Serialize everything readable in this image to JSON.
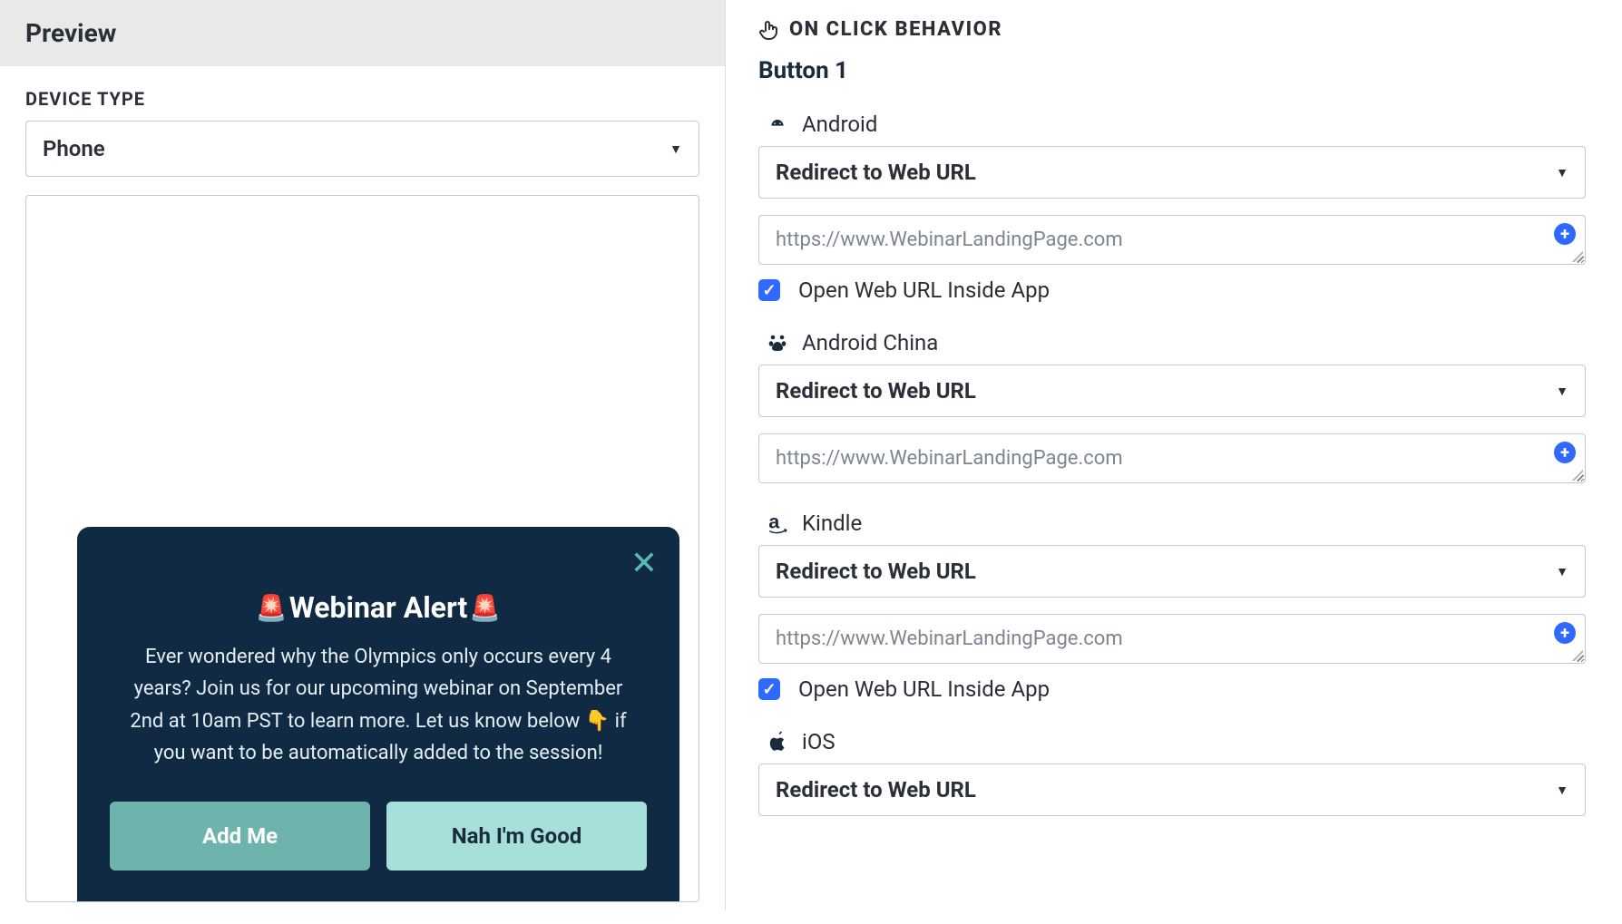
{
  "left": {
    "header": "Preview",
    "deviceTypeLabel": "DEVICE TYPE",
    "deviceTypeValue": "Phone",
    "notification": {
      "title": "Webinar Alert",
      "body": "Ever wondered why the Olympics only occurs every 4 years? Join us for our upcoming webinar on September 2nd at 10am PST to learn more. Let us know below 👇 if you want to be automatically added to the session!",
      "primaryBtn": "Add Me",
      "secondaryBtn": "Nah I'm Good"
    }
  },
  "right": {
    "sectionTitle": "ON CLICK BEHAVIOR",
    "subheader": "Button 1",
    "platforms": [
      {
        "name": "Android",
        "icon": "android-icon",
        "action": "Redirect to Web URL",
        "url": "https://www.WebinarLandingPage.com",
        "showCheck": true,
        "checkLabel": "Open Web URL Inside App",
        "checked": true
      },
      {
        "name": "Android China",
        "icon": "baidu-icon",
        "action": "Redirect to Web URL",
        "url": "https://www.WebinarLandingPage.com",
        "showCheck": false
      },
      {
        "name": "Kindle",
        "icon": "amazon-icon",
        "action": "Redirect to Web URL",
        "url": "https://www.WebinarLandingPage.com",
        "showCheck": true,
        "checkLabel": "Open Web URL Inside App",
        "checked": true
      },
      {
        "name": "iOS",
        "icon": "apple-icon",
        "action": "Redirect to Web URL",
        "url": "",
        "showCheck": false,
        "noUrlBox": true
      }
    ]
  }
}
